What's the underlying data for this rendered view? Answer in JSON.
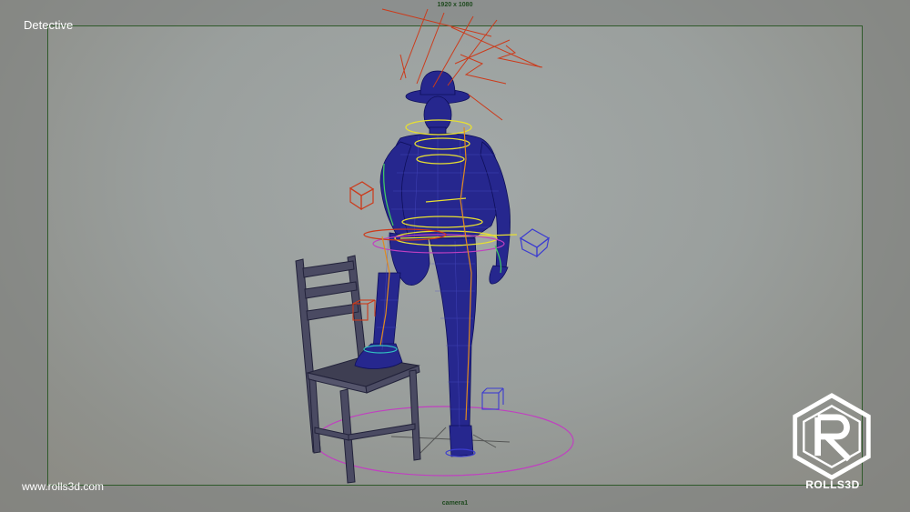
{
  "viewport": {
    "scene_title": "Detective",
    "resolution": "1920 x 1080",
    "camera": "camera1",
    "watermark": "www.rolls3d.com"
  },
  "brand": {
    "name": "ROLLS3D",
    "logo_icon": "rolls3d-hexagon-logo-icon"
  },
  "colors": {
    "wireframe": "#1a1a8c",
    "gate_border": "#2f5a2a",
    "ik_handle": "#cc3a1a",
    "control_yellow": "#e8e030",
    "control_magenta": "#c040c0",
    "control_blue": "#3c3cd0"
  }
}
